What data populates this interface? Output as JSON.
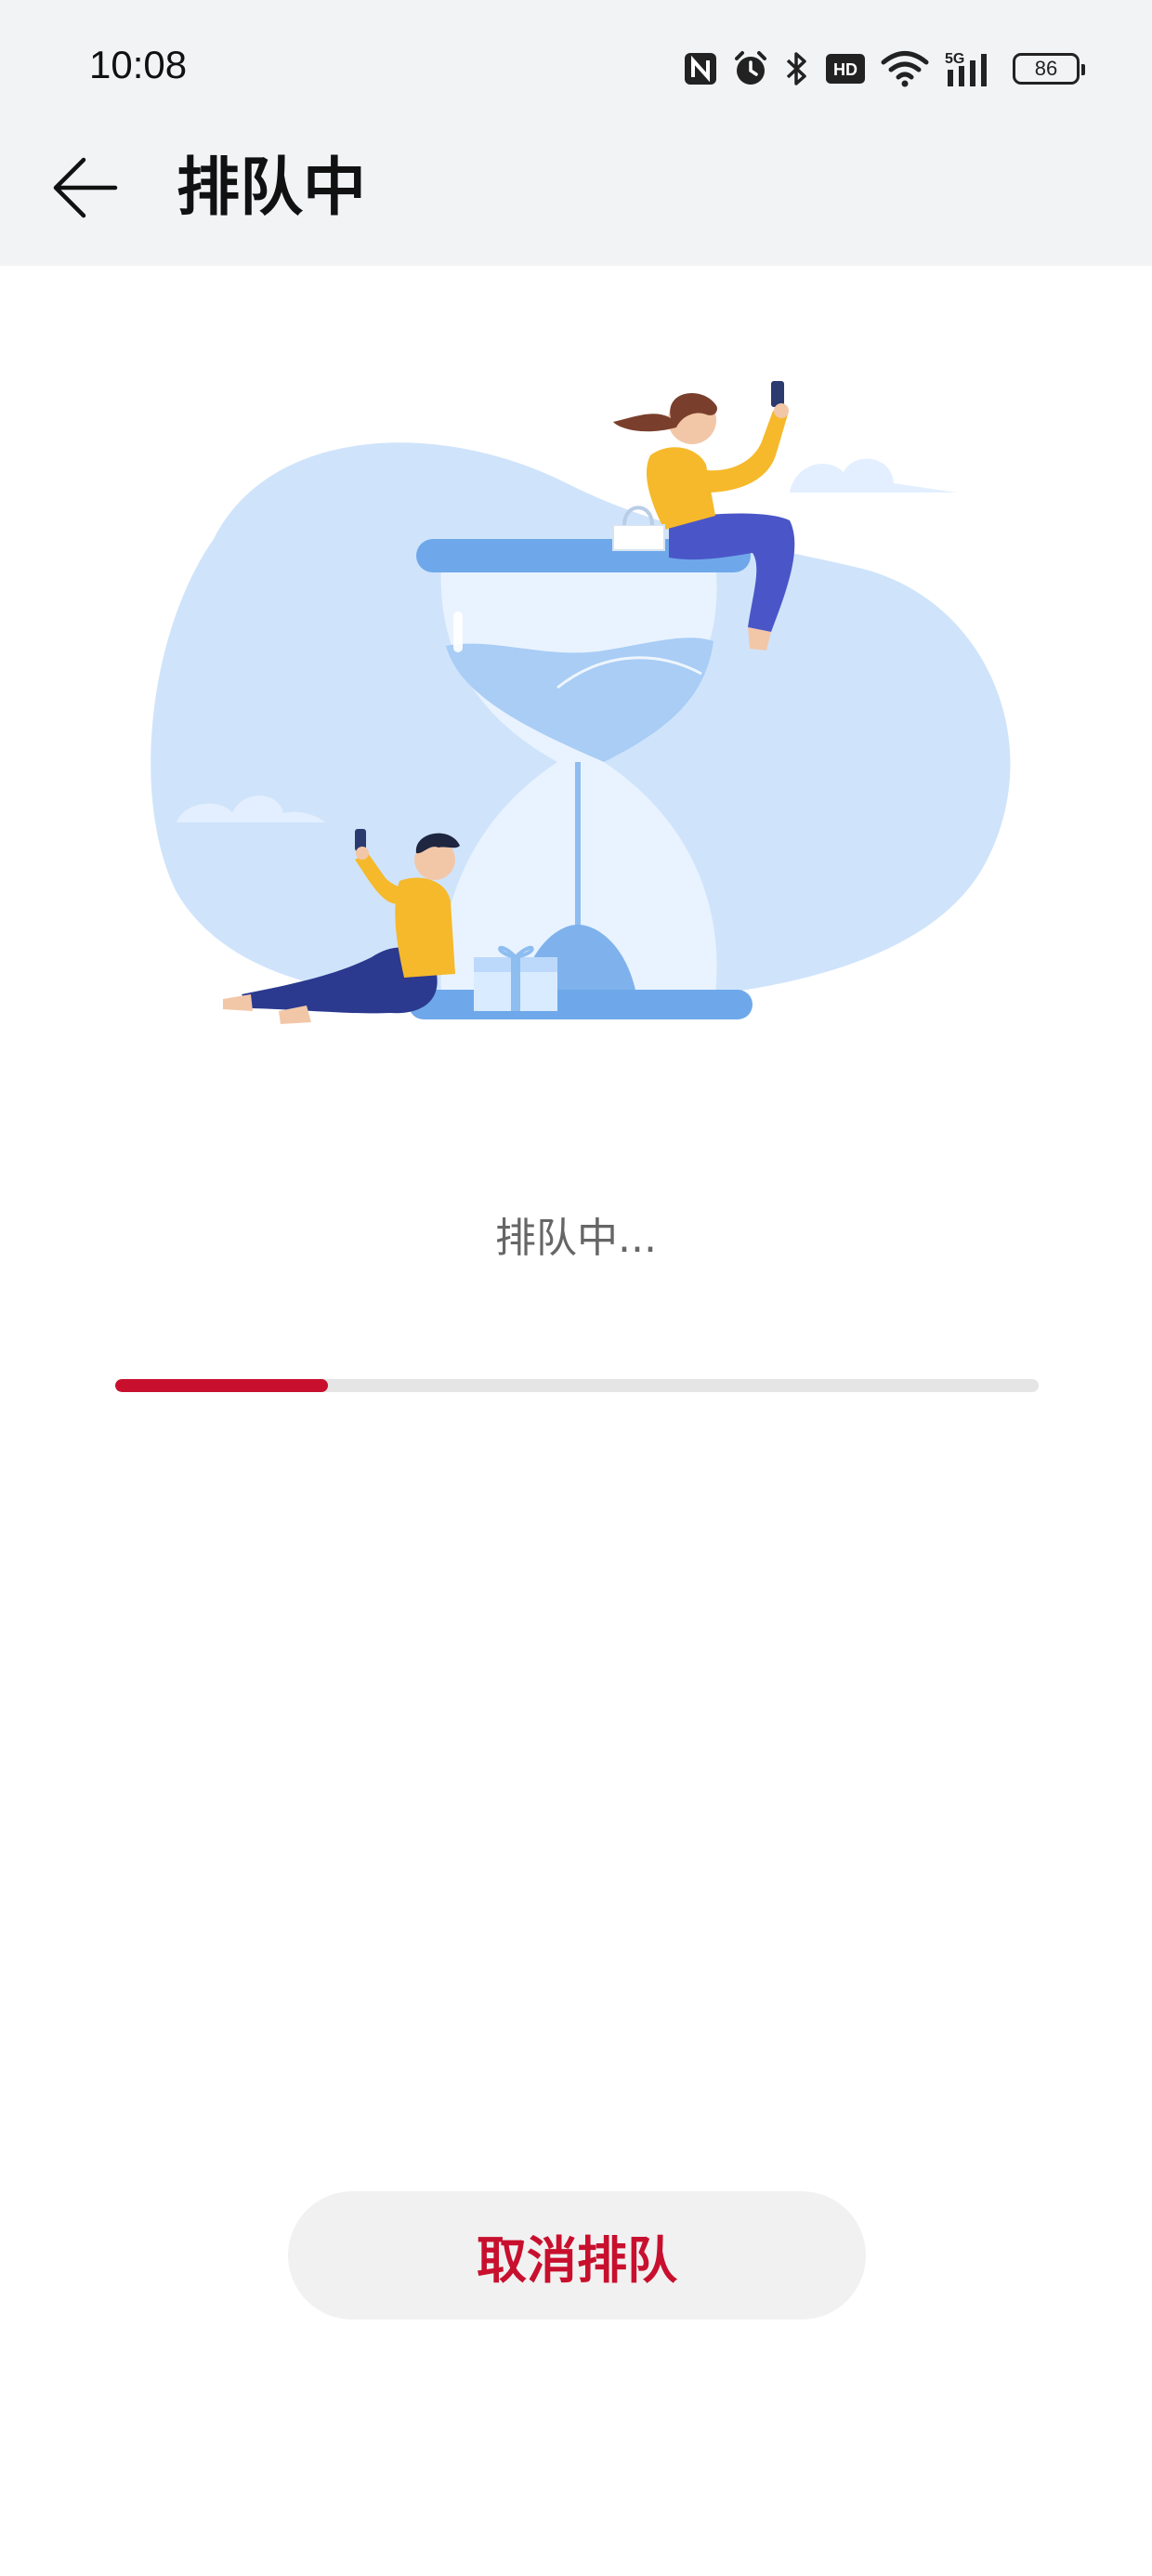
{
  "status_bar": {
    "time": "10:08",
    "icons": [
      "nfc-icon",
      "alarm-icon",
      "bluetooth-icon",
      "hd-icon",
      "wifi-icon",
      "signal-5g-icon"
    ],
    "network_label": "5G",
    "hd_label": "HD",
    "battery": "86"
  },
  "header": {
    "back_icon": "arrow-left-icon",
    "title": "排队中"
  },
  "illustration": {
    "subject": "hourglass-waiting-illustration"
  },
  "queue": {
    "status_text": "排队中...",
    "progress_percent": 23
  },
  "actions": {
    "cancel_label": "取消排队"
  },
  "colors": {
    "accent": "#c8102e",
    "header_bg": "#f1f3f5",
    "track": "#e5e5e5",
    "illustration_blue": "#cfe4fb",
    "figure_yellow": "#f6b92b",
    "figure_navy": "#2b3a8f"
  }
}
